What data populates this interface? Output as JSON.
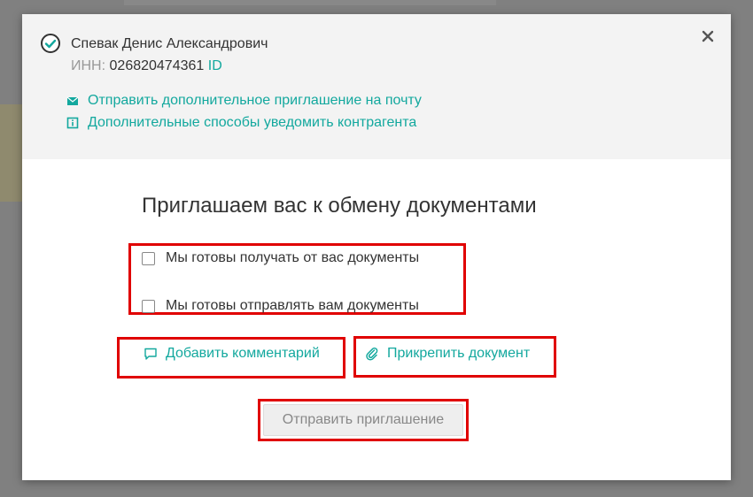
{
  "contact": {
    "name": "Спевак Денис Александрович",
    "inn_label": "ИНН:",
    "inn_value": "026820474361",
    "id_link": "ID"
  },
  "header_links": {
    "send_invite": "Отправить дополнительное приглашение на почту",
    "notify_methods": "Дополнительные способы уведомить контрагента"
  },
  "invite": {
    "title": "Приглашаем вас к обмену документами",
    "option_receive": "Мы готовы получать от вас документы",
    "option_send": "Мы готовы отправлять вам документы",
    "add_comment": "Добавить комментарий",
    "attach_document": "Прикрепить документ",
    "submit": "Отправить приглашение"
  },
  "colors": {
    "accent": "#13a89e",
    "highlight": "#e00000",
    "text": "#333333",
    "muted": "#999999"
  },
  "icons": {
    "status": "check-circle-icon",
    "close": "close-icon",
    "mail": "envelope-icon",
    "info": "info-icon",
    "comment": "comment-icon",
    "attach": "paperclip-icon"
  }
}
